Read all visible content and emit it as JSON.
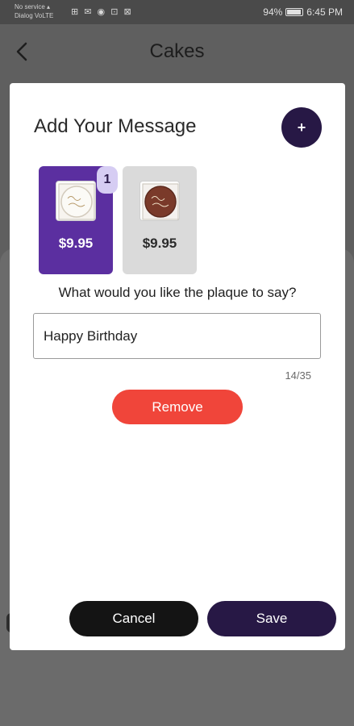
{
  "status_bar": {
    "carrier_line1": "No service ▴",
    "carrier_line2": "Dialog VoLTE",
    "icons": "⊞ ✉ ◉ ⊡ ⊠",
    "battery_percent": "94%",
    "time": "6:45 PM"
  },
  "header": {
    "title": "Cakes",
    "back_icon": "chevron-left-icon"
  },
  "modal": {
    "title": "Add Your Message",
    "add_label": "+",
    "options": [
      {
        "price": "$9.95",
        "selected": true,
        "quantity": "1",
        "plaque_style": "white-plaque",
        "plaque_text": "Happy Birthday"
      },
      {
        "price": "$9.95",
        "selected": false,
        "plaque_style": "chocolate-plaque",
        "plaque_text": "Happy Birthday"
      }
    ],
    "question": "What would you like the plaque to say?",
    "input_value": "Happy Birthday",
    "char_count": "14/35",
    "remove_label": "Remove",
    "cancel_label": "Cancel",
    "save_label": "Save"
  },
  "colors": {
    "accent_purple": "#5b2fa0",
    "dark_purple": "#271845",
    "remove_red": "#f0453a",
    "badge_lavender": "#d6cdf3"
  }
}
